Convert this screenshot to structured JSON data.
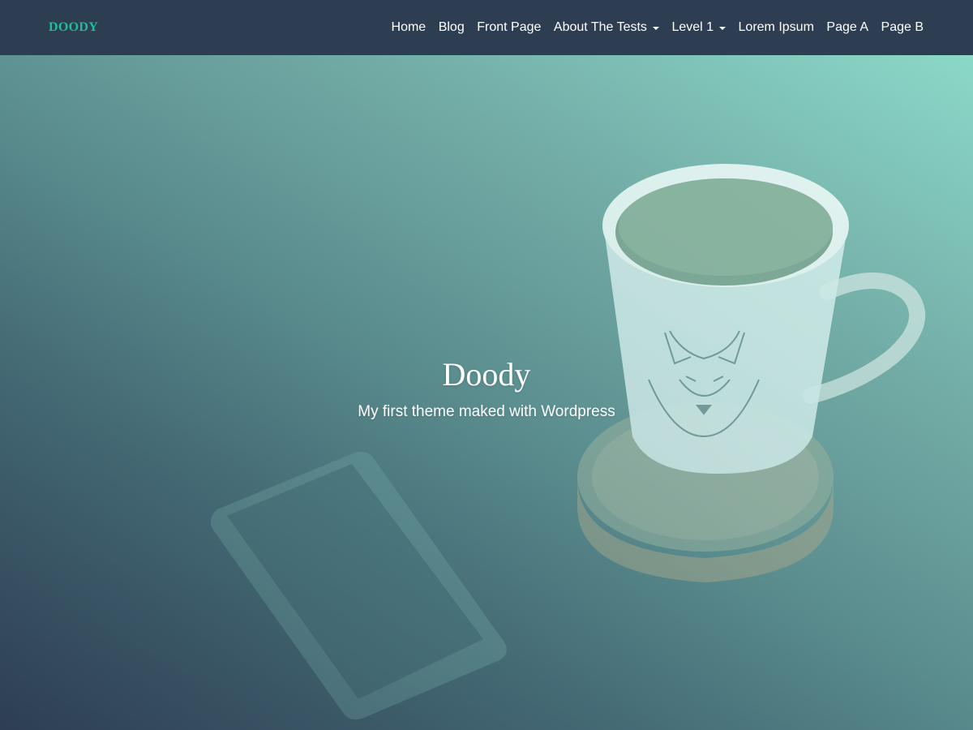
{
  "navbar": {
    "brand": "DOODY",
    "items": [
      {
        "label": "Home",
        "dropdown": false
      },
      {
        "label": "Blog",
        "dropdown": false
      },
      {
        "label": "Front Page",
        "dropdown": false
      },
      {
        "label": "About The Tests",
        "dropdown": true
      },
      {
        "label": "Level 1",
        "dropdown": true
      },
      {
        "label": "Lorem Ipsum",
        "dropdown": false
      },
      {
        "label": "Page A",
        "dropdown": false
      },
      {
        "label": "Page B",
        "dropdown": false
      }
    ]
  },
  "hero": {
    "title": "Doody",
    "tagline": "My first theme maked with Wordpress",
    "background_image": "coffee-mug-wolf-phone-image"
  },
  "colors": {
    "navbar_bg": "#2e3e52",
    "brand": "#1ebf9a",
    "overlay_dark": "#2e3f55",
    "overlay_light": "#8bd8c8"
  }
}
